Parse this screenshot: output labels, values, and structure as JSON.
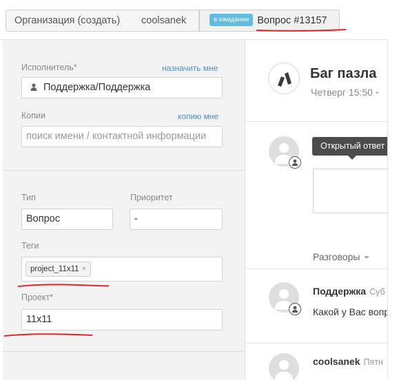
{
  "tabs": {
    "organization": "Организация (создать)",
    "user": "coolsanek",
    "ticket_status": "в ожидании",
    "ticket": "Вопрос #13157"
  },
  "sidebar": {
    "assignee": {
      "label": "Исполнитель*",
      "link": "назначить мне",
      "value": "Поддержка/Поддержка"
    },
    "cc": {
      "label": "Копии",
      "link": "копию мне",
      "placeholder": "поиск имени / контактной информации"
    },
    "type": {
      "label": "Тип",
      "value": "Вопрос"
    },
    "priority": {
      "label": "Приоритет",
      "value": "-"
    },
    "tags": {
      "label": "Теги",
      "items": [
        "project_11x11"
      ],
      "remove": "×"
    },
    "project": {
      "label": "Проект*",
      "value": "11x11"
    }
  },
  "ticket": {
    "title": "Баг пазла",
    "time": "Четверг 15:50"
  },
  "composer": {
    "tooltip": "Открытый ответ"
  },
  "conversations": {
    "label": "Разговоры",
    "items": [
      {
        "author": "Поддержка",
        "meta": "Суб",
        "text": "Какой у Вас вопрос"
      },
      {
        "author": "coolsanek",
        "meta": "Пятн",
        "text": ""
      }
    ]
  },
  "colors": {
    "accent_link": "#4a8fc2",
    "status_badge": "#5ebde0",
    "annotation_red": "#e0262b"
  }
}
